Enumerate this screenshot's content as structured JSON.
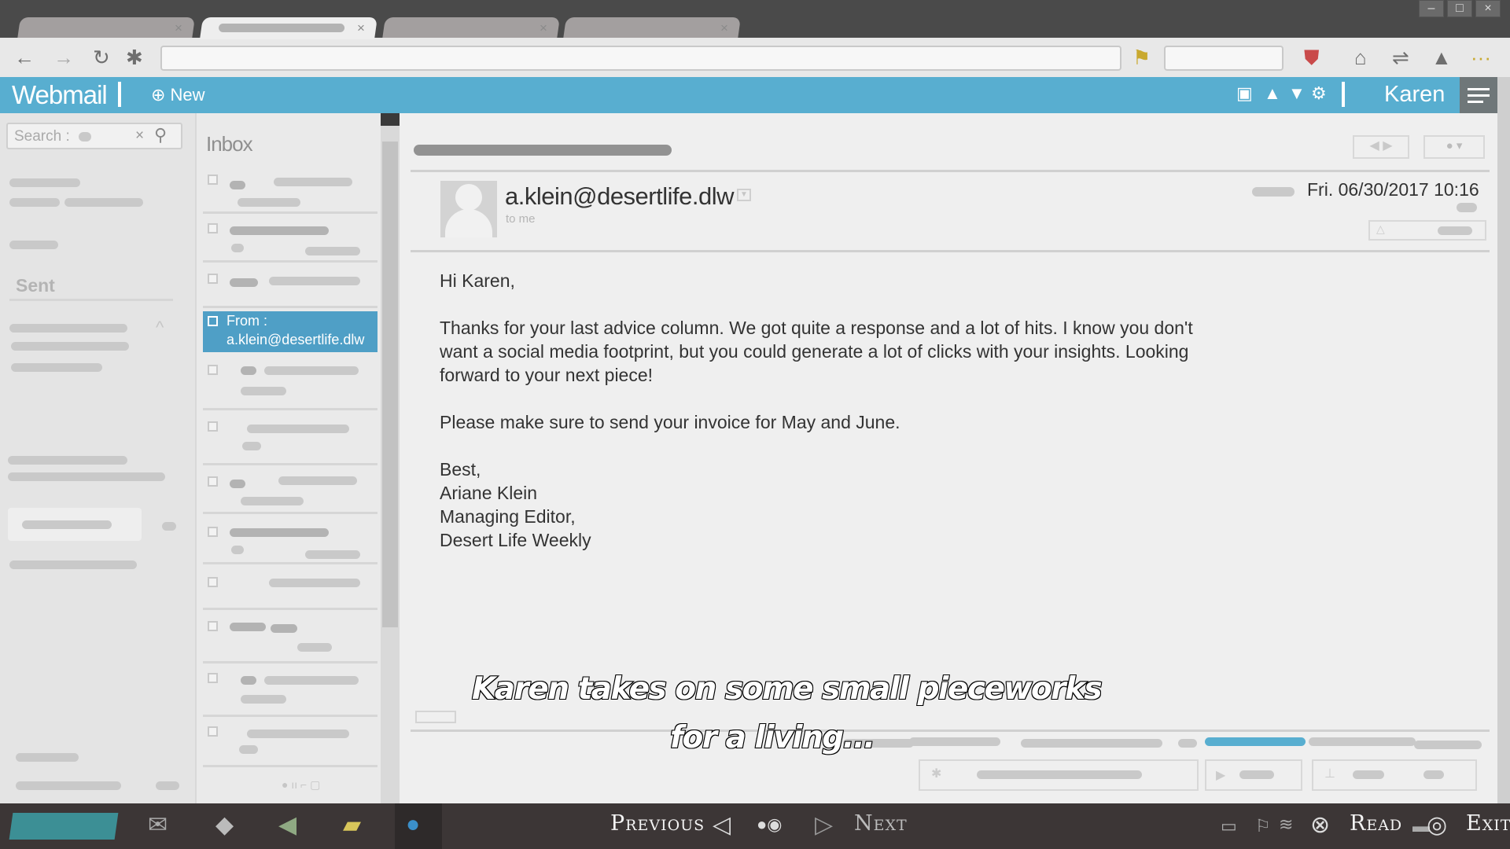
{
  "app": {
    "brand": "Webmail",
    "new_label": "New",
    "user": "Karen"
  },
  "search": {
    "label": "Search :"
  },
  "folders": {
    "sent": "Sent"
  },
  "list": {
    "title": "Inbox",
    "selected": {
      "from_label": "From :",
      "from_address": "a.klein@desertlife.dlw"
    }
  },
  "email": {
    "sender": "a.klein@desertlife.dlw",
    "to": "to me",
    "date": "Fri. 06/30/2017 10:16",
    "greeting": "Hi Karen,",
    "paragraph1_line1": "Thanks for your last advice column. We got quite a response and a lot of hits. I know you don't",
    "paragraph1_line2": "want a social media footprint, but you could generate a lot of clicks with your insights. Looking",
    "paragraph1_line3": "forward to your next piece!",
    "paragraph2": "Please make sure to send your invoice for May and June.",
    "sign1": "Best,",
    "sign2": "Ariane Klein",
    "sign3": "Managing Editor,",
    "sign4": "Desert Life Weekly"
  },
  "subtitle": {
    "line1": "Karen takes on some small pieceworks",
    "line2": "for a living..."
  },
  "prompts": {
    "previous": "Previous",
    "next": "Next",
    "read": "Read",
    "exit": "Exit"
  },
  "icons": [
    "back-arrow-icon",
    "forward-arrow-icon",
    "reload-icon",
    "puzzle-icon",
    "bookmark-icon",
    "shield-icon",
    "lock-icon",
    "sync-icon",
    "warning-icon",
    "more-icon",
    "new-plus-icon",
    "checkbox-icon",
    "arrow-up-icon",
    "arrow-down-icon",
    "gear-icon",
    "menu-icon",
    "search-icon",
    "clear-icon",
    "wifi-icon",
    "cross-button-icon",
    "circle-button-icon"
  ],
  "colors": {
    "accent": "#58aed0",
    "selection": "#4f9fc6",
    "taskbar": "#3c3636"
  }
}
